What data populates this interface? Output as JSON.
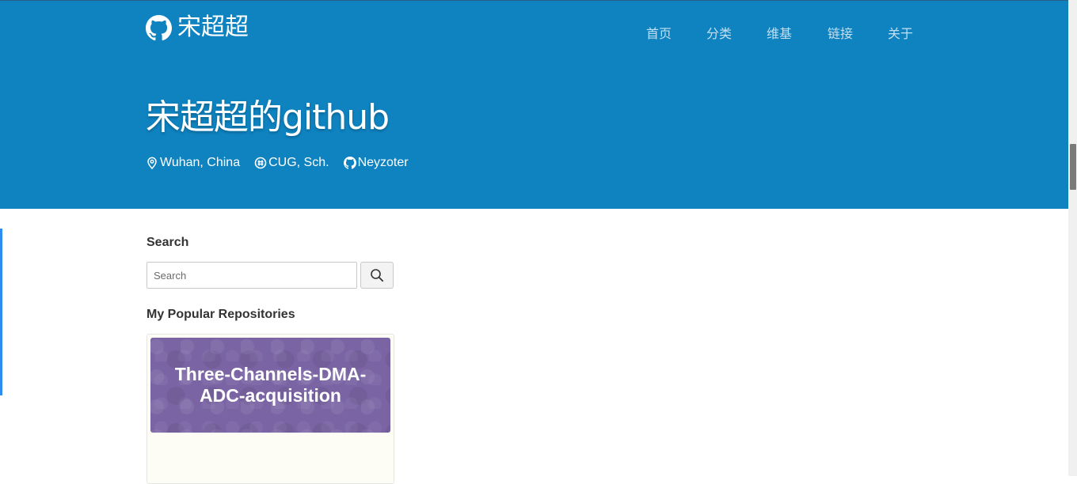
{
  "header": {
    "brand": {
      "label": "宋超超",
      "icon": "github-icon"
    },
    "nav": [
      "首页",
      "分类",
      "维基",
      "链接",
      "关于"
    ],
    "title": "宋超超的github",
    "meta": [
      {
        "icon": "map-marker-icon",
        "text": "Wuhan, China"
      },
      {
        "icon": "university-icon",
        "text": "CUG, Sch."
      },
      {
        "icon": "github-icon",
        "text": "Neyzoter"
      }
    ]
  },
  "sidebar": {
    "search_title": "Search",
    "search_placeholder": "Search",
    "search_value": "",
    "search_button_icon": "magnifier-icon",
    "repos_title": "My Popular Repositories",
    "repos": [
      {
        "name": "Three-Channels-DMA-ADC-acquisition"
      }
    ]
  },
  "colors": {
    "header_bg": "#0e83c0",
    "nav_text": "#c4dff0",
    "repo_banner": "#7a64a4",
    "accent": "#2e8ef0"
  }
}
